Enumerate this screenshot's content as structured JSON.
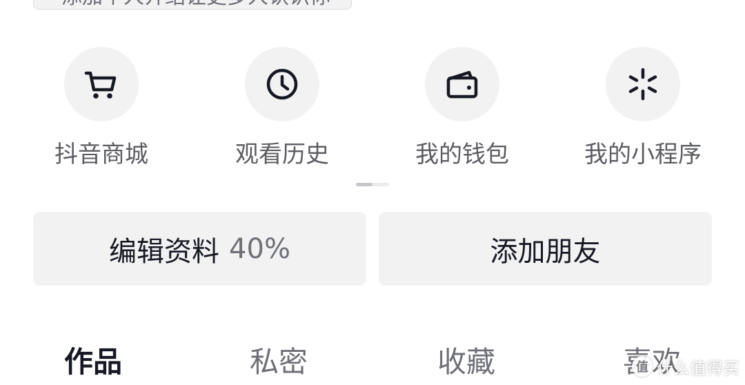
{
  "top_chip": {
    "text": "添加个人介绍让更多人认识你"
  },
  "shortcuts": [
    {
      "label": "抖音商城",
      "icon": "cart-icon"
    },
    {
      "label": "观看历史",
      "icon": "clock-icon"
    },
    {
      "label": "我的钱包",
      "icon": "wallet-icon"
    },
    {
      "label": "我的小程序",
      "icon": "mini-program-icon"
    }
  ],
  "pager": {
    "pages": 2,
    "current": 1
  },
  "actions": {
    "edit_profile_label": "编辑资料",
    "edit_profile_progress": "40%",
    "add_friend_label": "添加朋友"
  },
  "tabs": [
    {
      "label": "作品",
      "active": true
    },
    {
      "label": "私密",
      "active": false
    },
    {
      "label": "收藏",
      "active": false
    },
    {
      "label": "喜欢",
      "active": false
    }
  ],
  "watermark": {
    "badge": "值",
    "text": "什么值得买"
  },
  "colors": {
    "primary_text": "#161823",
    "secondary_text": "#5c5d63",
    "muted_text": "#6f7077",
    "surface": "#f2f2f3"
  }
}
